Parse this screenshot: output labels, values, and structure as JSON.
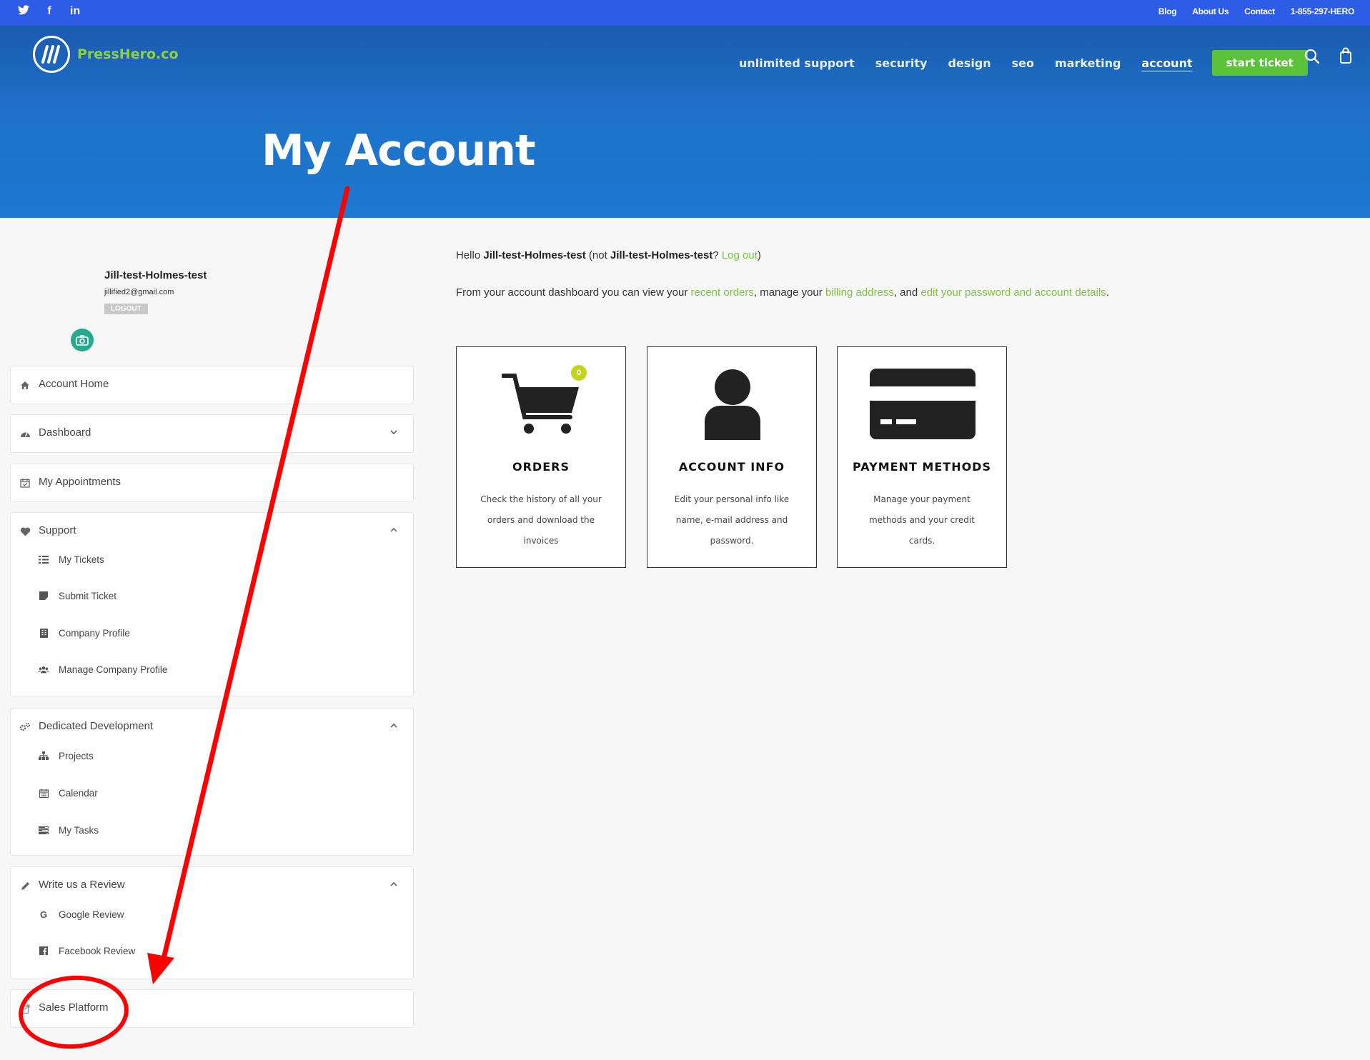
{
  "topbar": {
    "social": [
      {
        "name": "twitter-icon",
        "glyph": "🐦"
      },
      {
        "name": "facebook-icon",
        "glyph": "f"
      },
      {
        "name": "linkedin-icon",
        "glyph": "in"
      }
    ],
    "links": [
      "Blog",
      "About Us",
      "Contact",
      "1-855-297-HERO"
    ]
  },
  "header": {
    "logo_text": "PressHero.co",
    "nav": [
      "unlimited support",
      "security",
      "design",
      "seo",
      "marketing",
      "account"
    ],
    "active_nav": "account",
    "cta_label": "start ticket",
    "page_title": "My Account"
  },
  "profile": {
    "name": "Jill-test-Holmes-test",
    "email": "jillified2@gmail.com",
    "logout_label": "LOGOUT"
  },
  "sidebar": {
    "account_home": "Account Home",
    "dashboard": "Dashboard",
    "appointments": "My Appointments",
    "support": {
      "label": "Support",
      "items": [
        "My Tickets",
        "Submit Ticket",
        "Company Profile",
        "Manage Company Profile"
      ]
    },
    "dedicated": {
      "label": "Dedicated Development",
      "items": [
        "Projects",
        "Calendar",
        "My Tasks"
      ]
    },
    "review": {
      "label": "Write us a Review",
      "items": [
        "Google Review",
        "Facebook Review"
      ]
    },
    "sales": "Sales Platform"
  },
  "main": {
    "hello_prefix": "Hello ",
    "hello_name": "Jill-test-Holmes-test",
    "hello_mid": " (not ",
    "hello_name2": "Jill-test-Holmes-test",
    "hello_q": "? ",
    "logout_link": "Log out",
    "hello_close": ")",
    "desc_prefix": "From your account dashboard you can view your ",
    "desc_link1": "recent orders",
    "desc_mid1": ", manage your ",
    "desc_link2": "billing address",
    "desc_mid2": ", and ",
    "desc_link3": "edit your password and account details",
    "desc_end": ".",
    "cards": [
      {
        "title": "ORDERS",
        "desc": "Check the history of all your orders and download the invoices",
        "badge": "0"
      },
      {
        "title": "ACCOUNT INFO",
        "desc": "Edit your personal info like name, e-mail address and password."
      },
      {
        "title": "PAYMENT METHODS",
        "desc": "Manage your payment methods and your credit cards."
      }
    ]
  },
  "colors": {
    "topbar": "#2d5de6",
    "hero": "#1f72c8",
    "accent_green": "#7cc242",
    "cta_green": "#5cc23a",
    "annotation_red": "#ff0000"
  }
}
